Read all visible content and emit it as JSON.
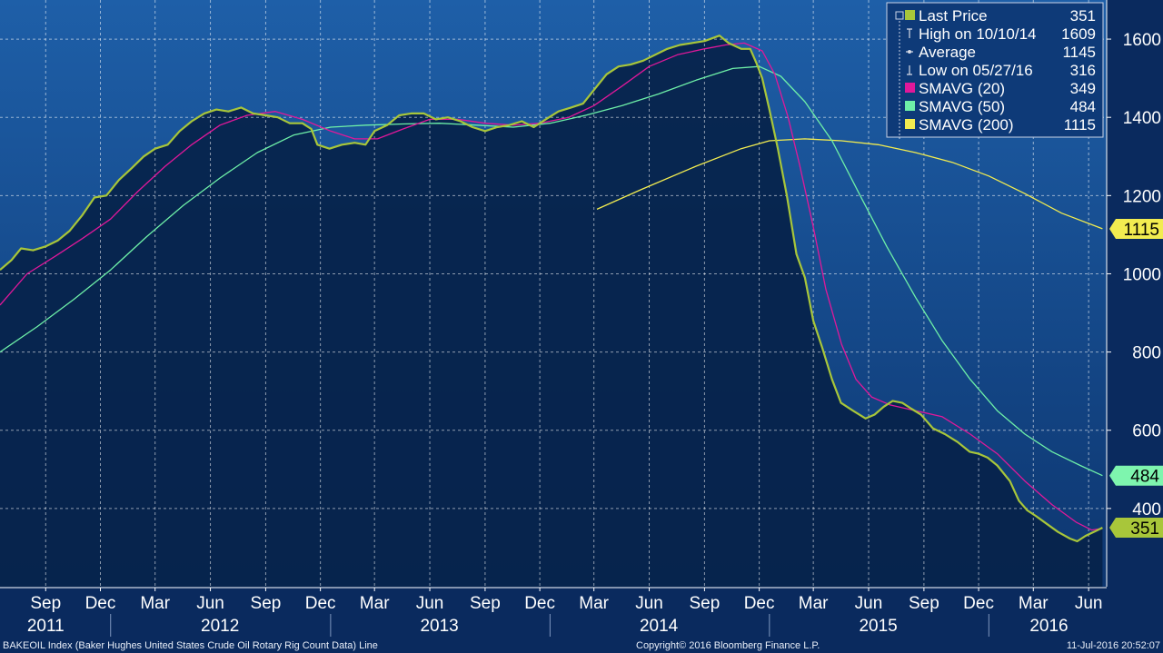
{
  "chart_data": {
    "type": "line",
    "title": "BAKEOIL Index (Baker Hughes United States Crude Oil Rotary Rig Count Data) Line",
    "copyright": "Copyright© 2016 Bloomberg Finance L.P.",
    "timestamp": "11-Jul-2016 20:52:07",
    "ylim": [
      200,
      1700
    ],
    "y_ticks": [
      400,
      600,
      800,
      1000,
      1200,
      1400,
      1600
    ],
    "y_tick_labels": [
      "400",
      "600",
      "800",
      "1000",
      "1200",
      "1400",
      "1600"
    ],
    "x_range": [
      "2011-07-01",
      "2016-07-15"
    ],
    "month_ticks": [
      {
        "date": "2011-09-15",
        "label": "Sep"
      },
      {
        "date": "2011-12-15",
        "label": "Dec"
      },
      {
        "date": "2012-03-15",
        "label": "Mar"
      },
      {
        "date": "2012-06-15",
        "label": "Jun"
      },
      {
        "date": "2012-09-15",
        "label": "Sep"
      },
      {
        "date": "2012-12-15",
        "label": "Dec"
      },
      {
        "date": "2013-03-15",
        "label": "Mar"
      },
      {
        "date": "2013-06-15",
        "label": "Jun"
      },
      {
        "date": "2013-09-15",
        "label": "Sep"
      },
      {
        "date": "2013-12-15",
        "label": "Dec"
      },
      {
        "date": "2014-03-15",
        "label": "Mar"
      },
      {
        "date": "2014-06-15",
        "label": "Jun"
      },
      {
        "date": "2014-09-15",
        "label": "Sep"
      },
      {
        "date": "2014-12-15",
        "label": "Dec"
      },
      {
        "date": "2015-03-15",
        "label": "Mar"
      },
      {
        "date": "2015-06-15",
        "label": "Jun"
      },
      {
        "date": "2015-09-15",
        "label": "Sep"
      },
      {
        "date": "2015-12-15",
        "label": "Dec"
      },
      {
        "date": "2016-03-15",
        "label": "Mar"
      },
      {
        "date": "2016-06-15",
        "label": "Jun"
      }
    ],
    "year_labels": [
      {
        "date": "2011-09-15",
        "label": "2011"
      },
      {
        "date": "2012-07-01",
        "label": "2012"
      },
      {
        "date": "2013-07-01",
        "label": "2013"
      },
      {
        "date": "2014-07-01",
        "label": "2014"
      },
      {
        "date": "2015-07-01",
        "label": "2015"
      },
      {
        "date": "2016-04-10",
        "label": "2016"
      }
    ],
    "year_separators": [
      "2012-01-01",
      "2013-01-01",
      "2014-01-01",
      "2015-01-01",
      "2016-01-01"
    ],
    "grid": true,
    "legend_position": "top-right",
    "legend": [
      {
        "label": "Last Price",
        "value": "351",
        "marker": "square",
        "color": "#a8c63a"
      },
      {
        "label": "High on 10/10/14",
        "value": "1609",
        "marker": "high",
        "color": "#d7dbe6"
      },
      {
        "label": "Average",
        "value": "1145",
        "marker": "average",
        "color": "#d7dbe6"
      },
      {
        "label": "Low on 05/27/16",
        "value": "316",
        "marker": "low",
        "color": "#d7dbe6"
      },
      {
        "label": "SMAVG (20)",
        "value": "349",
        "marker": "square",
        "color": "#e0189a"
      },
      {
        "label": "SMAVG (50)",
        "value": "484",
        "marker": "square",
        "color": "#6ef0a8"
      },
      {
        "label": "SMAVG (200)",
        "value": "1115",
        "marker": "square",
        "color": "#f2ec50"
      }
    ],
    "value_tags": [
      {
        "value": 1115,
        "label": "1115",
        "color": "#f2ec50"
      },
      {
        "value": 484,
        "label": "484",
        "color": "#7ef5ae"
      },
      {
        "value": 351,
        "label": "351",
        "color": "#a8c63a"
      }
    ],
    "series": [
      {
        "name": "Last Price",
        "color": "#a8c63a",
        "fill": true,
        "points": [
          [
            "2011-07-01",
            1010
          ],
          [
            "2011-07-20",
            1035
          ],
          [
            "2011-08-05",
            1065
          ],
          [
            "2011-08-25",
            1060
          ],
          [
            "2011-09-15",
            1070
          ],
          [
            "2011-10-05",
            1085
          ],
          [
            "2011-10-25",
            1110
          ],
          [
            "2011-11-15",
            1150
          ],
          [
            "2011-12-05",
            1195
          ],
          [
            "2011-12-25",
            1200
          ],
          [
            "2012-01-15",
            1240
          ],
          [
            "2012-02-05",
            1270
          ],
          [
            "2012-02-25",
            1300
          ],
          [
            "2012-03-15",
            1320
          ],
          [
            "2012-04-05",
            1330
          ],
          [
            "2012-04-25",
            1365
          ],
          [
            "2012-05-15",
            1390
          ],
          [
            "2012-06-05",
            1410
          ],
          [
            "2012-06-25",
            1420
          ],
          [
            "2012-07-15",
            1415
          ],
          [
            "2012-08-05",
            1425
          ],
          [
            "2012-08-25",
            1410
          ],
          [
            "2012-09-15",
            1405
          ],
          [
            "2012-10-05",
            1400
          ],
          [
            "2012-10-25",
            1385
          ],
          [
            "2012-11-15",
            1385
          ],
          [
            "2012-11-30",
            1370
          ],
          [
            "2012-12-10",
            1330
          ],
          [
            "2012-12-30",
            1320
          ],
          [
            "2013-01-20",
            1330
          ],
          [
            "2013-02-10",
            1335
          ],
          [
            "2013-02-28",
            1330
          ],
          [
            "2013-03-15",
            1365
          ],
          [
            "2013-04-05",
            1380
          ],
          [
            "2013-04-25",
            1405
          ],
          [
            "2013-05-15",
            1410
          ],
          [
            "2013-06-05",
            1410
          ],
          [
            "2013-06-25",
            1395
          ],
          [
            "2013-07-15",
            1400
          ],
          [
            "2013-08-05",
            1390
          ],
          [
            "2013-08-25",
            1375
          ],
          [
            "2013-09-15",
            1365
          ],
          [
            "2013-10-05",
            1375
          ],
          [
            "2013-10-25",
            1380
          ],
          [
            "2013-11-15",
            1390
          ],
          [
            "2013-12-05",
            1375
          ],
          [
            "2013-12-25",
            1395
          ],
          [
            "2014-01-15",
            1415
          ],
          [
            "2014-02-05",
            1425
          ],
          [
            "2014-02-25",
            1435
          ],
          [
            "2014-03-15",
            1470
          ],
          [
            "2014-04-05",
            1510
          ],
          [
            "2014-04-25",
            1530
          ],
          [
            "2014-05-15",
            1535
          ],
          [
            "2014-06-05",
            1545
          ],
          [
            "2014-06-25",
            1560
          ],
          [
            "2014-07-15",
            1575
          ],
          [
            "2014-08-05",
            1585
          ],
          [
            "2014-08-25",
            1590
          ],
          [
            "2014-09-15",
            1595
          ],
          [
            "2014-10-10",
            1609
          ],
          [
            "2014-10-25",
            1590
          ],
          [
            "2014-11-15",
            1575
          ],
          [
            "2014-11-30",
            1575
          ],
          [
            "2014-12-10",
            1540
          ],
          [
            "2014-12-20",
            1500
          ],
          [
            "2015-01-01",
            1420
          ],
          [
            "2015-01-15",
            1320
          ],
          [
            "2015-01-30",
            1200
          ],
          [
            "2015-02-15",
            1050
          ],
          [
            "2015-03-01",
            990
          ],
          [
            "2015-03-15",
            880
          ],
          [
            "2015-03-30",
            810
          ],
          [
            "2015-04-15",
            730
          ],
          [
            "2015-04-30",
            670
          ],
          [
            "2015-05-20",
            650
          ],
          [
            "2015-06-10",
            630
          ],
          [
            "2015-06-25",
            640
          ],
          [
            "2015-07-10",
            660
          ],
          [
            "2015-07-25",
            675
          ],
          [
            "2015-08-10",
            670
          ],
          [
            "2015-08-25",
            655
          ],
          [
            "2015-09-10",
            640
          ],
          [
            "2015-09-30",
            605
          ],
          [
            "2015-10-20",
            590
          ],
          [
            "2015-11-10",
            570
          ],
          [
            "2015-11-30",
            545
          ],
          [
            "2015-12-15",
            540
          ],
          [
            "2015-12-30",
            530
          ],
          [
            "2016-01-15",
            510
          ],
          [
            "2016-02-05",
            470
          ],
          [
            "2016-02-20",
            420
          ],
          [
            "2016-03-05",
            395
          ],
          [
            "2016-03-20",
            380
          ],
          [
            "2016-04-05",
            362
          ],
          [
            "2016-04-25",
            340
          ],
          [
            "2016-05-15",
            323
          ],
          [
            "2016-05-27",
            316
          ],
          [
            "2016-06-10",
            330
          ],
          [
            "2016-06-25",
            341
          ],
          [
            "2016-07-08",
            351
          ]
        ]
      },
      {
        "name": "SMAVG (20)",
        "color": "#e0189a",
        "fill": false,
        "points": [
          [
            "2011-07-01",
            920
          ],
          [
            "2011-08-15",
            1000
          ],
          [
            "2011-10-01",
            1045
          ],
          [
            "2011-11-15",
            1090
          ],
          [
            "2012-01-01",
            1140
          ],
          [
            "2012-02-15",
            1210
          ],
          [
            "2012-04-01",
            1275
          ],
          [
            "2012-05-15",
            1330
          ],
          [
            "2012-07-01",
            1380
          ],
          [
            "2012-08-15",
            1405
          ],
          [
            "2012-10-01",
            1415
          ],
          [
            "2012-11-15",
            1395
          ],
          [
            "2013-01-01",
            1365
          ],
          [
            "2013-02-10",
            1345
          ],
          [
            "2013-03-20",
            1345
          ],
          [
            "2013-05-01",
            1370
          ],
          [
            "2013-06-15",
            1395
          ],
          [
            "2013-08-01",
            1395
          ],
          [
            "2013-09-15",
            1385
          ],
          [
            "2013-11-01",
            1380
          ],
          [
            "2013-12-15",
            1385
          ],
          [
            "2014-02-01",
            1400
          ],
          [
            "2014-03-15",
            1430
          ],
          [
            "2014-05-01",
            1480
          ],
          [
            "2014-06-15",
            1530
          ],
          [
            "2014-08-01",
            1560
          ],
          [
            "2014-09-15",
            1575
          ],
          [
            "2014-10-20",
            1585
          ],
          [
            "2014-11-20",
            1590
          ],
          [
            "2014-12-20",
            1570
          ],
          [
            "2015-01-10",
            1510
          ],
          [
            "2015-02-01",
            1400
          ],
          [
            "2015-02-20",
            1280
          ],
          [
            "2015-03-15",
            1120
          ],
          [
            "2015-04-05",
            960
          ],
          [
            "2015-05-01",
            820
          ],
          [
            "2015-05-25",
            730
          ],
          [
            "2015-06-20",
            685
          ],
          [
            "2015-07-20",
            665
          ],
          [
            "2015-09-01",
            650
          ],
          [
            "2015-10-15",
            635
          ],
          [
            "2015-12-01",
            590
          ],
          [
            "2016-01-15",
            540
          ],
          [
            "2016-03-01",
            470
          ],
          [
            "2016-04-15",
            410
          ],
          [
            "2016-05-25",
            365
          ],
          [
            "2016-06-20",
            345
          ],
          [
            "2016-07-08",
            349
          ]
        ]
      },
      {
        "name": "SMAVG (50)",
        "color": "#6ef0a8",
        "fill": false,
        "points": [
          [
            "2011-07-01",
            800
          ],
          [
            "2011-09-01",
            865
          ],
          [
            "2011-11-01",
            935
          ],
          [
            "2012-01-01",
            1010
          ],
          [
            "2012-03-01",
            1095
          ],
          [
            "2012-05-01",
            1175
          ],
          [
            "2012-07-01",
            1245
          ],
          [
            "2012-09-01",
            1310
          ],
          [
            "2012-11-01",
            1355
          ],
          [
            "2013-01-01",
            1375
          ],
          [
            "2013-03-01",
            1380
          ],
          [
            "2013-05-01",
            1383
          ],
          [
            "2013-07-01",
            1385
          ],
          [
            "2013-09-01",
            1380
          ],
          [
            "2013-11-01",
            1375
          ],
          [
            "2014-01-01",
            1385
          ],
          [
            "2014-03-01",
            1405
          ],
          [
            "2014-05-01",
            1430
          ],
          [
            "2014-07-01",
            1460
          ],
          [
            "2014-09-01",
            1495
          ],
          [
            "2014-11-01",
            1525
          ],
          [
            "2014-12-15",
            1530
          ],
          [
            "2015-01-20",
            1505
          ],
          [
            "2015-03-01",
            1440
          ],
          [
            "2015-04-15",
            1340
          ],
          [
            "2015-06-01",
            1200
          ],
          [
            "2015-07-15",
            1070
          ],
          [
            "2015-09-01",
            940
          ],
          [
            "2015-10-15",
            830
          ],
          [
            "2015-12-01",
            730
          ],
          [
            "2016-01-15",
            650
          ],
          [
            "2016-03-01",
            590
          ],
          [
            "2016-04-15",
            545
          ],
          [
            "2016-06-01",
            510
          ],
          [
            "2016-07-08",
            484
          ]
        ]
      },
      {
        "name": "SMAVG (200)",
        "color": "#f2ec50",
        "fill": false,
        "points": [
          [
            "2014-03-20",
            1165
          ],
          [
            "2014-06-01",
            1215
          ],
          [
            "2014-09-01",
            1275
          ],
          [
            "2014-11-15",
            1320
          ],
          [
            "2015-01-01",
            1340
          ],
          [
            "2015-03-01",
            1345
          ],
          [
            "2015-05-01",
            1340
          ],
          [
            "2015-07-01",
            1330
          ],
          [
            "2015-09-01",
            1310
          ],
          [
            "2015-11-01",
            1285
          ],
          [
            "2016-01-01",
            1250
          ],
          [
            "2016-03-01",
            1205
          ],
          [
            "2016-05-01",
            1155
          ],
          [
            "2016-07-08",
            1115
          ]
        ]
      }
    ]
  }
}
